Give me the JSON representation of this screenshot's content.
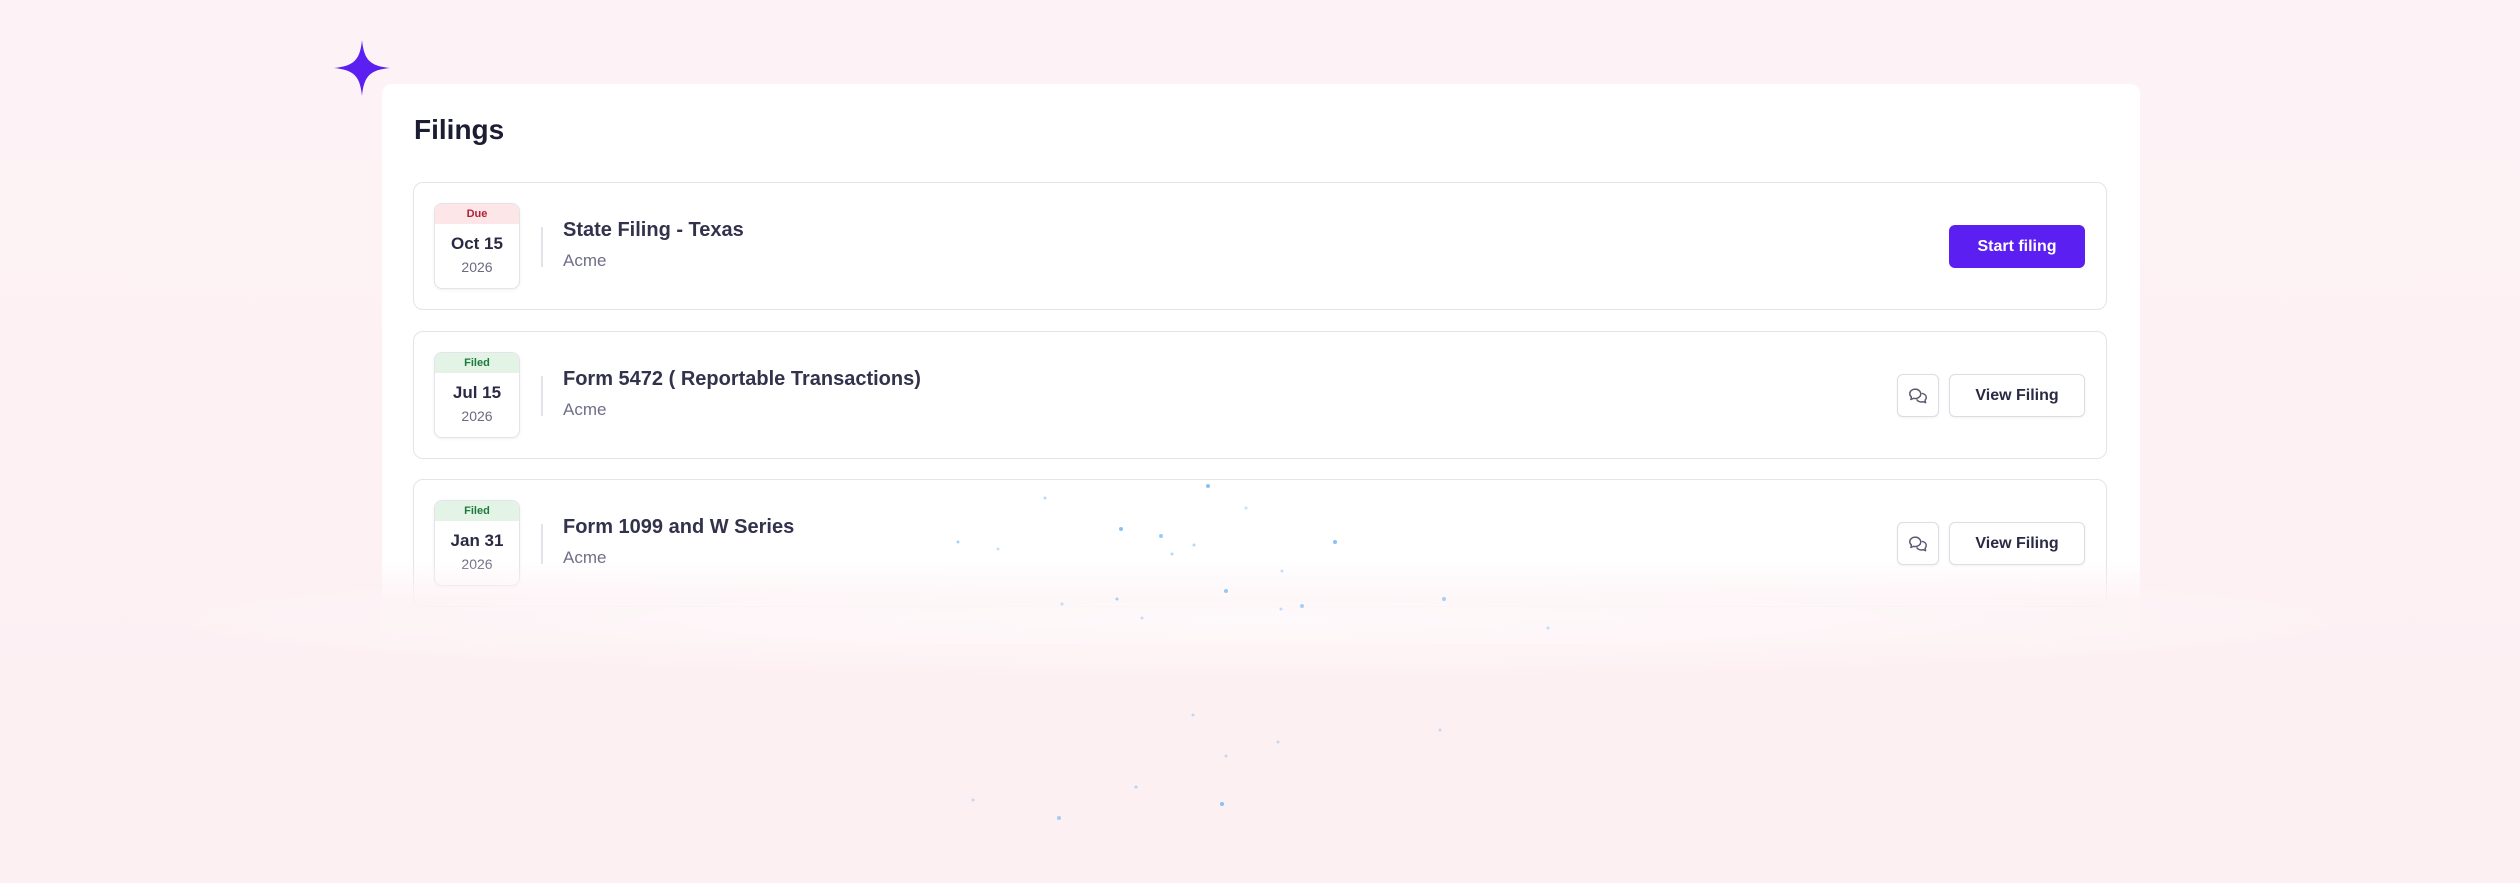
{
  "page": {
    "title": "Filings",
    "accent_color": "#5b1ff2"
  },
  "filings": [
    {
      "status": "Due",
      "status_color": "#b2203a",
      "date": "Oct 15",
      "year": "2026",
      "title": "State Filing - Texas",
      "company": "Acme",
      "action_label": "Start filing"
    },
    {
      "status": "Filed",
      "status_color": "#1e7a3a",
      "date": "Jul 15",
      "year": "2026",
      "title": "Form 5472 ( Reportable Transactions)",
      "company": "Acme",
      "action_label": "View Filing",
      "icon": "chat-bubbles-icon"
    },
    {
      "status": "Filed",
      "status_color": "#1e7a3a",
      "date": "Jan 31",
      "year": "2026",
      "title": "Form 1099 and W Series",
      "company": "Acme",
      "action_label": "View Filing",
      "icon": "chat-bubbles-icon"
    }
  ]
}
